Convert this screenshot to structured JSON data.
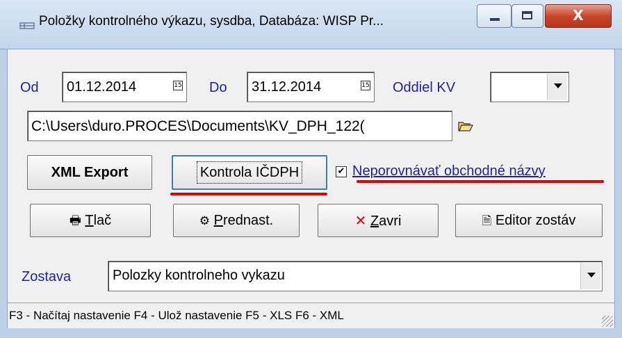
{
  "window": {
    "title": "Položky kontrolného výkazu, sysdba,  Databáza: WISP Pr...",
    "controls": {
      "minimize": "—",
      "maximize": "□",
      "close": "X"
    }
  },
  "filters": {
    "od_label": "Od",
    "od_value": "01.12.2014",
    "do_label": "Do",
    "do_value": "31.12.2014",
    "oddiel_label": "Oddiel KV",
    "oddiel_value": "",
    "calendar_glyph": "15"
  },
  "path": {
    "value": "C:\\Users\\duro.PROCES\\Documents\\KV_DPH_122("
  },
  "actions": {
    "xml_export": "XML Export",
    "kontrola": "Kontrola IČDPH",
    "checkbox_label": "Neporovnávať obchodné názvy",
    "checkbox_checked": true,
    "tlac_prefix": "T",
    "tlac_rest": "lač",
    "prednast_prefix": "P",
    "prednast_rest": "rednast.",
    "zavri_prefix": "Z",
    "zavri_rest": "avri",
    "editor": "Editor zostáv"
  },
  "zostava": {
    "label": "Zostava",
    "value": "Polozky kontrolneho vykazu"
  },
  "status": {
    "text": "F3 - Načítaj nastavenie   F4 - Ulož nastavenie   F5 - XLS   F6 - XML"
  },
  "colors": {
    "label_blue": "#1f1f9f",
    "highlight_red": "#e00000",
    "close_red": "#c9462c"
  },
  "icons": [
    "app-icon",
    "calendar-icon",
    "folder-icon",
    "printer-icon",
    "settings-icon",
    "close-x-icon",
    "editor-icon",
    "checkbox-check-icon"
  ]
}
